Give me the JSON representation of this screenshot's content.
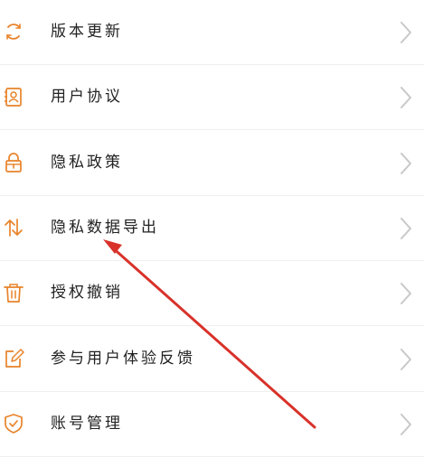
{
  "accent_color": "#E8832A",
  "chevron_color": "#c8c8c8",
  "annotation_color": "#D8322A",
  "menu": {
    "items": [
      {
        "label": "版本更新",
        "icon": "refresh-icon"
      },
      {
        "label": "用户协议",
        "icon": "contact-book-icon"
      },
      {
        "label": "隐私政策",
        "icon": "lock-icon"
      },
      {
        "label": "隐私数据导出",
        "icon": "export-arrows-icon"
      },
      {
        "label": "授权撤销",
        "icon": "trash-icon"
      },
      {
        "label": "参与用户体验反馈",
        "icon": "edit-icon"
      },
      {
        "label": "账号管理",
        "icon": "shield-check-icon"
      }
    ]
  }
}
